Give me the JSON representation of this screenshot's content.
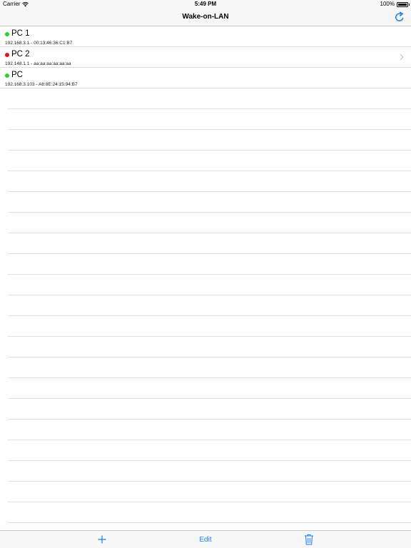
{
  "status_bar": {
    "carrier": "Carrier",
    "time": "5:49 PM",
    "battery": "100%"
  },
  "nav": {
    "title": "Wake-on-LAN",
    "refresh_icon": "refresh-icon"
  },
  "devices": [
    {
      "name": "PC 1",
      "detail": "192.168.3.1 - 00:13:46:36:C1:B7",
      "status_color": "#2ad32a"
    },
    {
      "name": "PC 2",
      "detail": "192.148.1.1 - aa:aa:aa:aa:aa:aa",
      "status_color": "#e0121b"
    },
    {
      "name": "PC",
      "detail": "192.168.3.103 - A8:8E:24:15:94:B7",
      "status_color": "#2ad32a"
    }
  ],
  "toolbar": {
    "add_icon": "plus-icon",
    "edit_label": "Edit",
    "trash_icon": "trash-icon"
  },
  "colors": {
    "accent": "#1a7ef5",
    "online": "#2ad32a",
    "offline": "#e0121b"
  }
}
